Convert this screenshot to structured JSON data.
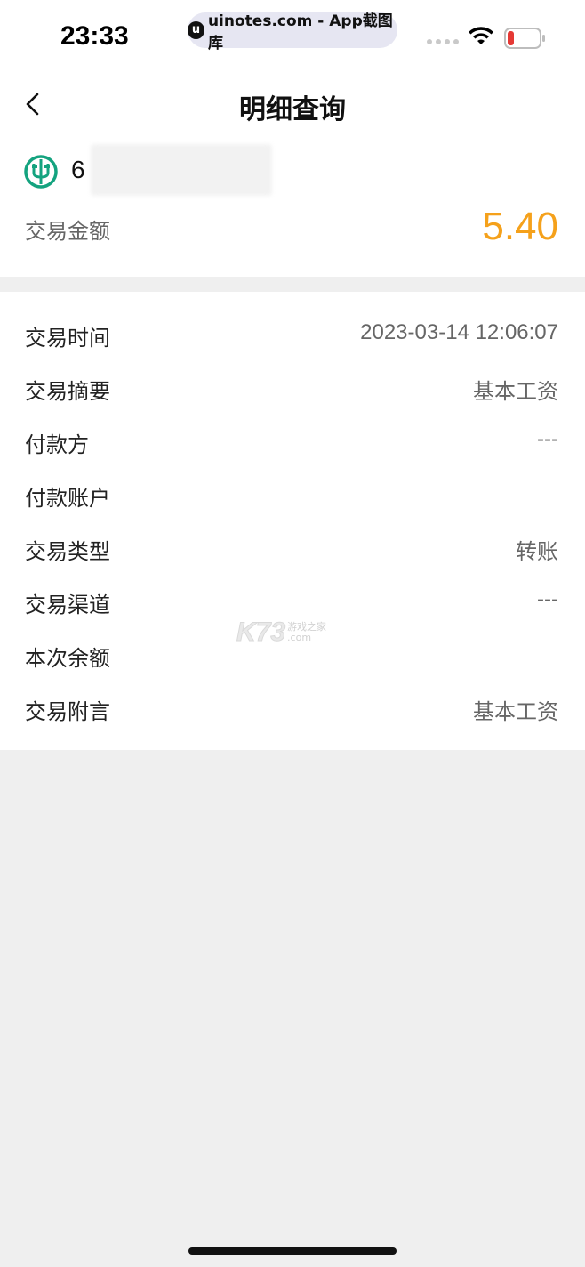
{
  "status_bar": {
    "time": "23:33",
    "url_text": "uinotes.com - App截图库",
    "url_logo": "u",
    "battery_color": "#e53935"
  },
  "nav": {
    "title": "明细查询"
  },
  "account": {
    "number_prefix": "6",
    "bank_logo_icon": "abc-bank-logo-icon",
    "bank_color": "#14a37f",
    "amount_label": "交易金额",
    "amount": "5.40",
    "amount_color": "#f5a11b"
  },
  "details": [
    {
      "label": "交易时间",
      "value": "2023-03-14 12:06:07"
    },
    {
      "label": "交易摘要",
      "value": "基本工资"
    },
    {
      "label": "付款方",
      "value": "---"
    },
    {
      "label": "付款账户",
      "value": ""
    },
    {
      "label": "交易类型",
      "value": "转账"
    },
    {
      "label": "交易渠道",
      "value": "---"
    },
    {
      "label": "本次余额",
      "value": ""
    },
    {
      "label": "交易附言",
      "value": "基本工资"
    }
  ],
  "watermark": {
    "main": "K73",
    "sub_top": "游戏之家",
    "sub_bottom": ".com"
  }
}
